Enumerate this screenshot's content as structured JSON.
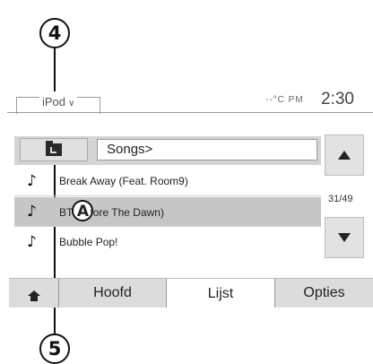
{
  "callouts": {
    "top": "4",
    "bottom": "5",
    "list": "A"
  },
  "header": {
    "source": "iPod",
    "temperature": "--°C PM",
    "time": "2:30"
  },
  "browser": {
    "path": "Songs>"
  },
  "songs": [
    {
      "title": "Break Away (Feat. Room9)"
    },
    {
      "title": "BT",
      "title_end": "fore The Dawn)"
    },
    {
      "title": "Bubble Pop!"
    }
  ],
  "scroll": {
    "position": "31/49"
  },
  "tabs": {
    "home_icon": "home-icon",
    "t1": "Hoofd",
    "t2": "Lijst",
    "t3": "Opties"
  }
}
